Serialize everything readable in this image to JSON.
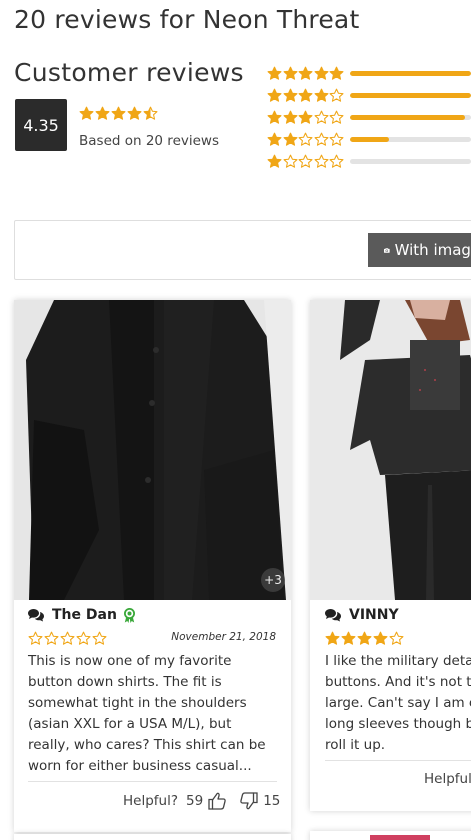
{
  "page": {
    "title": "20 reviews for Neon Threat"
  },
  "summary": {
    "section_title": "Customer reviews",
    "average": "4.35",
    "average_stars": 4.35,
    "based_on": "Based on 20 reviews"
  },
  "distribution": [
    {
      "stars": 5,
      "fill_fraction": 1.0
    },
    {
      "stars": 4,
      "fill_fraction": 1.0
    },
    {
      "stars": 3,
      "fill_fraction": 0.95
    },
    {
      "stars": 2,
      "fill_fraction": 0.32
    },
    {
      "stars": 1,
      "fill_fraction": 0.0
    }
  ],
  "filters": {
    "with_images_label": "With images",
    "with_images_icon": "camera-icon"
  },
  "reviews": [
    {
      "reviewer": "The Dan",
      "verified_icon": "award-ribbon-icon",
      "stars": 0,
      "date": "November 21, 2018",
      "text_lines": [
        "This is now one of my favorite",
        "button down shirts. The fit is",
        "somewhat tight in the shoulders",
        "(asian XXL for a USA M/L), but",
        "really, who cares? This shirt can be",
        "worn for either business casual..."
      ],
      "more_images": "+3",
      "helpful_label": "Helpful?",
      "helpful_up": "59",
      "helpful_down": "15"
    },
    {
      "reviewer": "VINNY",
      "stars": 4,
      "text_lines": [
        "I like the military detai",
        "buttons. And it's not to",
        "large. Can't say I am c",
        "long sleeves though b",
        "roll it up."
      ],
      "helpful_label": "Helpful"
    }
  ],
  "colors": {
    "star": "#f0a616",
    "bar_fill": "#f0a616",
    "bar_track": "#e3e3e3",
    "badge_green": "#3aa83a",
    "average_box": "#2b2b2b",
    "button": "#5a5a5a"
  }
}
